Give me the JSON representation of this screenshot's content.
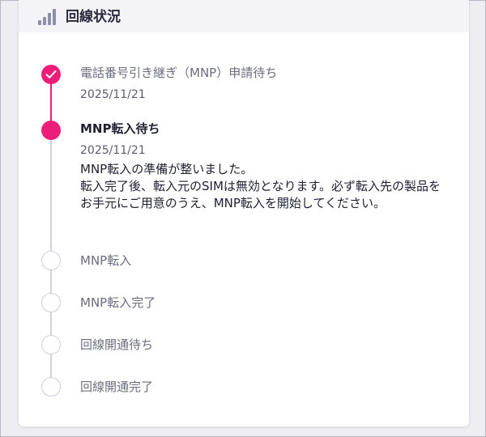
{
  "header": {
    "title": "回線状況",
    "icon": "signal-bars-icon",
    "icon_color": "#8e8ea8"
  },
  "colors": {
    "accent": "#ec1e79",
    "inactive": "#cfcfdc"
  },
  "steps": [
    {
      "title": "電話番号引き継ぎ（MNP）申請待ち",
      "date": "2025/11/21",
      "status": "done",
      "icon": "check-icon"
    },
    {
      "title": "MNP転入待ち",
      "date": "2025/11/21",
      "status": "current",
      "description": "MNP転入の準備が整いました。\n転入完了後、転入元のSIMは無効となります。必ず転入先の製品をお手元にご用意のうえ、MNP転入を開始してください。"
    },
    {
      "title": "MNP転入",
      "status": "pending"
    },
    {
      "title": "MNP転入完了",
      "status": "pending"
    },
    {
      "title": "回線開通待ち",
      "status": "pending"
    },
    {
      "title": "回線開通完了",
      "status": "pending"
    }
  ]
}
